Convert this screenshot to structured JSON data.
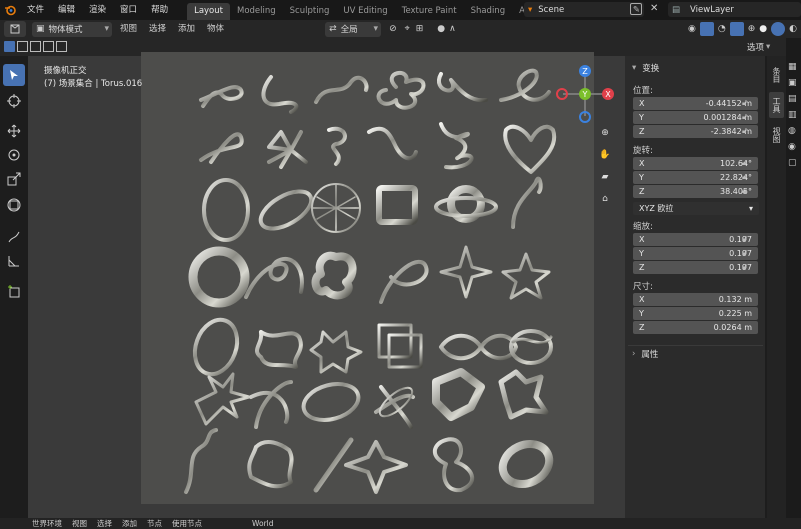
{
  "menu": {
    "file": "文件",
    "edit": "编辑",
    "render": "渲染",
    "window": "窗口",
    "help": "帮助"
  },
  "workspaces": [
    {
      "label": "Layout",
      "active": true
    },
    {
      "label": "Modeling",
      "active": false
    },
    {
      "label": "Sculpting",
      "active": false
    },
    {
      "label": "UV Editing",
      "active": false
    },
    {
      "label": "Texture Paint",
      "active": false
    },
    {
      "label": "Shading",
      "active": false
    },
    {
      "label": "Animation",
      "active": false
    }
  ],
  "scene": "Scene",
  "view_layer": "ViewLayer",
  "header": {
    "mode": "物体模式",
    "view": "视图",
    "select": "选择",
    "add": "添加",
    "object": "物体",
    "transform_orientation": "全局",
    "options": "选项"
  },
  "viewport_info": {
    "line1": "摄像机正交",
    "line2": "(7) 场景集合 | Torus.016"
  },
  "npanel": {
    "transform_title": "变换",
    "location_label": "位置:",
    "location": [
      {
        "axis": "X",
        "value": "-0.44152 m"
      },
      {
        "axis": "Y",
        "value": "0.001284 m"
      },
      {
        "axis": "Z",
        "value": "-2.3842 m"
      }
    ],
    "rotation_label": "旋转:",
    "rotation": [
      {
        "axis": "X",
        "value": "102.64°"
      },
      {
        "axis": "Y",
        "value": "22.824°"
      },
      {
        "axis": "Z",
        "value": "38.405°"
      }
    ],
    "rotation_mode": "XYZ 欧拉",
    "scale_label": "缩放:",
    "scale": [
      {
        "axis": "X",
        "value": "0.197"
      },
      {
        "axis": "Y",
        "value": "0.197"
      },
      {
        "axis": "Z",
        "value": "0.197"
      }
    ],
    "dimensions_label": "尺寸:",
    "dimensions": [
      {
        "axis": "X",
        "value": "0.132 m"
      },
      {
        "axis": "Y",
        "value": "0.225 m"
      },
      {
        "axis": "Z",
        "value": "0.0264 m"
      }
    ],
    "properties_title": "属性"
  },
  "side_tabs": {
    "item": "条目",
    "tool": "工具",
    "view": "视图"
  },
  "bottom": {
    "world_env": "世界环境",
    "view": "视图",
    "select": "选择",
    "add": "添加",
    "node": "节点",
    "use_nodes": "使用节点",
    "world": "World"
  },
  "colors": {
    "accent": "#4772b3",
    "axis_x": "#e0404a",
    "axis_y": "#7bbf2a",
    "axis_z": "#3b82e0"
  }
}
